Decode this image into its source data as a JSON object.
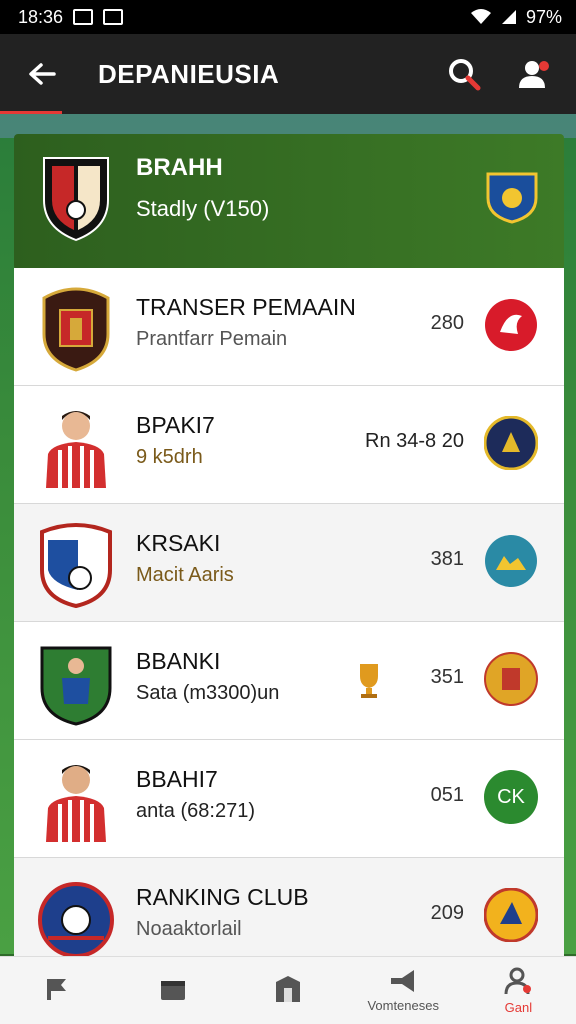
{
  "status_bar": {
    "time": "18:36",
    "battery": "97%"
  },
  "app_bar": {
    "title": "DEPANIEUSIA"
  },
  "hero": {
    "name": "BRAHH",
    "subtitle": "Stadly (V150)"
  },
  "rows": [
    {
      "title": "TRANSER PEMAAIN",
      "subtitle": "Prantfarr Pemain",
      "value": "280",
      "badge_color": "#d81b2a"
    },
    {
      "title": "BPAKI7",
      "subtitle": "9 k5drh",
      "value": "Rn 34-8 20",
      "badge_color": "#1d2b5a"
    },
    {
      "title": "KRSAKI",
      "subtitle": "Macit Aaris",
      "value": "381",
      "badge_color": "#2a8aa5"
    },
    {
      "title": "BBANKI",
      "subtitle": "Sata (m3300)un",
      "value": "351",
      "badge_color": "#e0a526"
    },
    {
      "title": "BBAHI7",
      "subtitle": "anta (68:271)",
      "value": "051",
      "badge_text": "CK",
      "badge_color": "#2b8a2f"
    },
    {
      "title": "RANKING CLUB",
      "subtitle": "Noaaktorlail",
      "value": "209",
      "badge_color": "#f2b21d"
    }
  ],
  "bottom_nav": [
    {
      "label": ""
    },
    {
      "label": ""
    },
    {
      "label": ""
    },
    {
      "label": "Vomteneses"
    },
    {
      "label": "Ganl"
    }
  ],
  "colors": {
    "accent": "#e53935",
    "appbar": "#222222",
    "hero": "#2d5f1e"
  }
}
